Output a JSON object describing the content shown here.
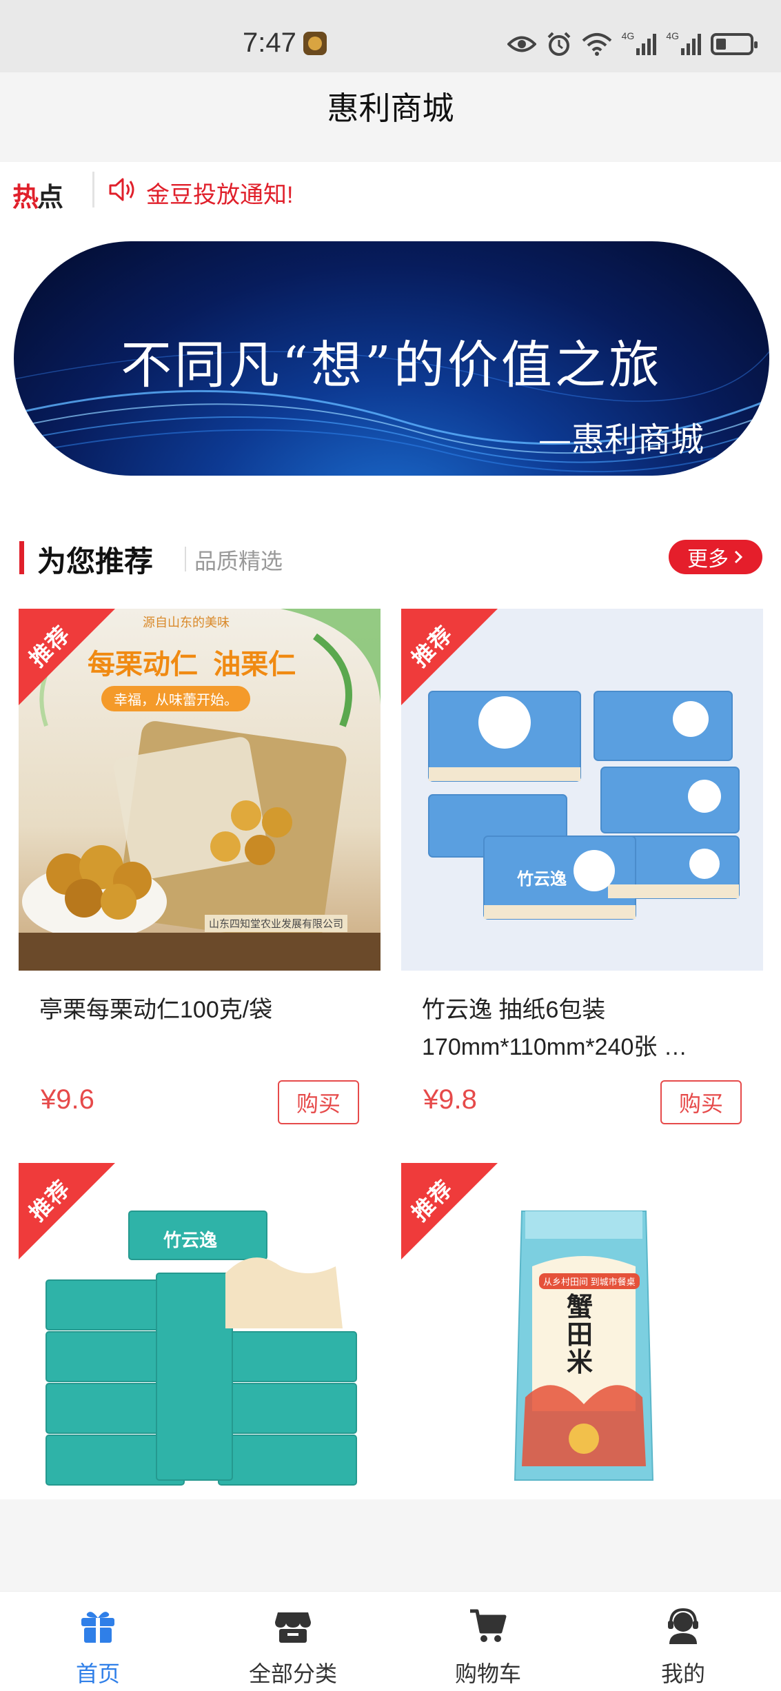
{
  "status_bar": {
    "time": "7:47",
    "net_badge_1": "4G",
    "net_badge_2": "4G"
  },
  "header": {
    "title": "惠利商城"
  },
  "hot": {
    "logo_a": "热",
    "logo_b": "点",
    "notice": "金豆投放通知!"
  },
  "banner": {
    "title": "不同凡“想”的价值之旅",
    "subtitle": "—惠利商城"
  },
  "section": {
    "title": "为您推荐",
    "subtitle": "品质精选",
    "more_label": "更多"
  },
  "products": [
    {
      "ribbon": "推荐",
      "name": "亭栗每栗动仁100克/袋",
      "price": "¥9.6",
      "buy_label": "购买",
      "img_text": {
        "top": "源自山东的美味",
        "headline": "每栗动仁  油栗仁",
        "pill": "幸福，从味蕾开始。",
        "maker": "山东四知堂农业发展有限公司"
      }
    },
    {
      "ribbon": "推荐",
      "name": "竹云逸 抽纸6包装 170mm*110mm*240张 …",
      "price": "¥9.8",
      "buy_label": "购买",
      "img_text": {
        "brand": "竹云逸"
      }
    },
    {
      "ribbon": "推荐",
      "img_text": {
        "brand": "竹云逸"
      }
    },
    {
      "ribbon": "推荐",
      "img_text": {
        "product": "蟹田米",
        "tag": "从乡村田间 到城市餐桌"
      }
    }
  ],
  "nav": [
    {
      "label": "首页",
      "icon": "gift-icon",
      "active": true
    },
    {
      "label": "全部分类",
      "icon": "store-icon",
      "active": false
    },
    {
      "label": "购物车",
      "icon": "cart-icon",
      "active": false
    },
    {
      "label": "我的",
      "icon": "user-headset-icon",
      "active": false
    }
  ],
  "colors": {
    "accent_red": "#e0202b",
    "price_red": "#e64a4a",
    "nav_active": "#2f7fe8"
  }
}
